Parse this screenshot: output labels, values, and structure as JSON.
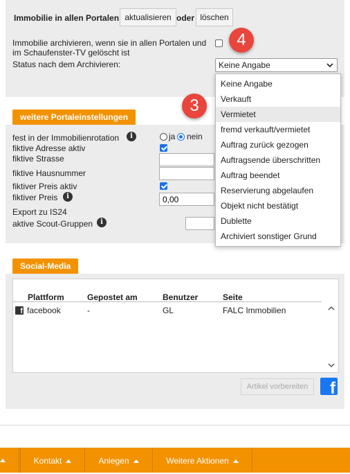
{
  "portals": {
    "label": "Immobilie in allen Portalen",
    "update_button": "aktualisieren",
    "or_label": "oder",
    "delete_button": "löschen"
  },
  "archive": {
    "label_line1": "Immobilie archivieren, wenn sie in allen Portalen und",
    "label_line2": "im Schaufenster-TV gelöscht ist",
    "status_label": "Status nach dem Archivieren:",
    "selected": "Keine Angabe",
    "options": [
      "Keine Angabe",
      "Verkauft",
      "Vermietet",
      "fremd verkauft/vermietet",
      "Auftrag zurück gezogen",
      "Auftragsende überschritten",
      "Auftrag beendet",
      "Reservierung abgelaufen",
      "Objekt nicht bestätigt",
      "Dublette",
      "Archiviert sonstiger Grund"
    ],
    "highlighted_option": "Vermietet"
  },
  "annotations": {
    "badge_a": "4",
    "badge_b": "3"
  },
  "portal_settings": {
    "tab_label": "weitere Portaleinstellungen",
    "rotation_label": "fest in der Immobilienrotation",
    "radio_yes": "ja",
    "radio_no": "nein",
    "rotation_value": "nein",
    "fake_address_active_label": "fiktive Adresse aktiv",
    "fake_address_active": true,
    "fake_street_label": "fiktive Strasse",
    "fake_street_value": "",
    "fake_house_number_label": "fiktive Hausnummer",
    "fake_house_number_value": "",
    "fake_price_active_label": "fiktiver Preis aktiv",
    "fake_price_active": true,
    "fake_price_label": "fiktiver Preis",
    "fake_price_value": "0,00",
    "export_label": "Export zu IS24",
    "scout_groups_label": "aktive Scout-Gruppen",
    "scout_groups_value": ""
  },
  "social_media": {
    "tab_label": "Social-Media",
    "columns": [
      "Plattform",
      "Gepostet am",
      "Benutzer",
      "Seite"
    ],
    "rows": [
      {
        "platform": "facebook",
        "posted": "-",
        "user": "GL",
        "page": "FALC Immobilien"
      }
    ],
    "prepare_button": "Artikel vorbereiten",
    "fb_glyph": "f"
  },
  "bottom_bar": {
    "items": [
      "Kontakt",
      "Anlegen",
      "Weitere Aktionen"
    ]
  },
  "colors": {
    "accent": "#f39200",
    "badge": "#e8463c",
    "checkbox": "#1a73e8",
    "facebook": "#1877f2"
  }
}
